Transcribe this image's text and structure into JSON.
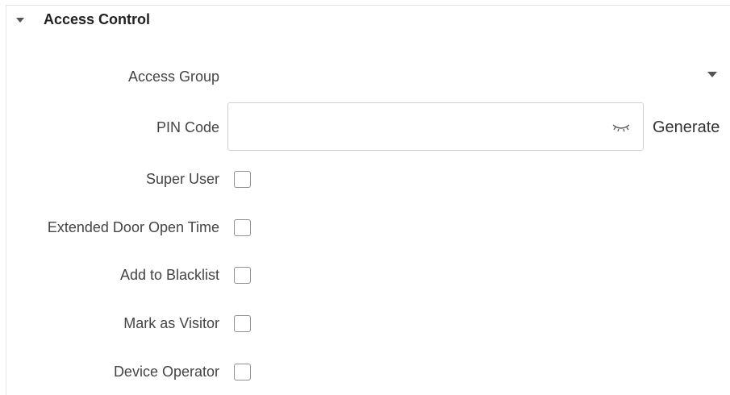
{
  "section": {
    "title": "Access Control",
    "icon": "caret-down-icon"
  },
  "fields": {
    "access_group": {
      "label": "Access Group",
      "value": ""
    },
    "pin_code": {
      "label": "PIN Code",
      "value": "",
      "placeholder": "",
      "action": "Generate"
    },
    "super_user": {
      "label": "Super User",
      "checked": false
    },
    "extended_door_open_time": {
      "label": "Extended Door Open Time",
      "checked": false
    },
    "add_to_blacklist": {
      "label": "Add to Blacklist",
      "checked": false
    },
    "mark_as_visitor": {
      "label": "Mark as Visitor",
      "checked": false
    },
    "device_operator": {
      "label": "Device Operator",
      "checked": false
    }
  }
}
